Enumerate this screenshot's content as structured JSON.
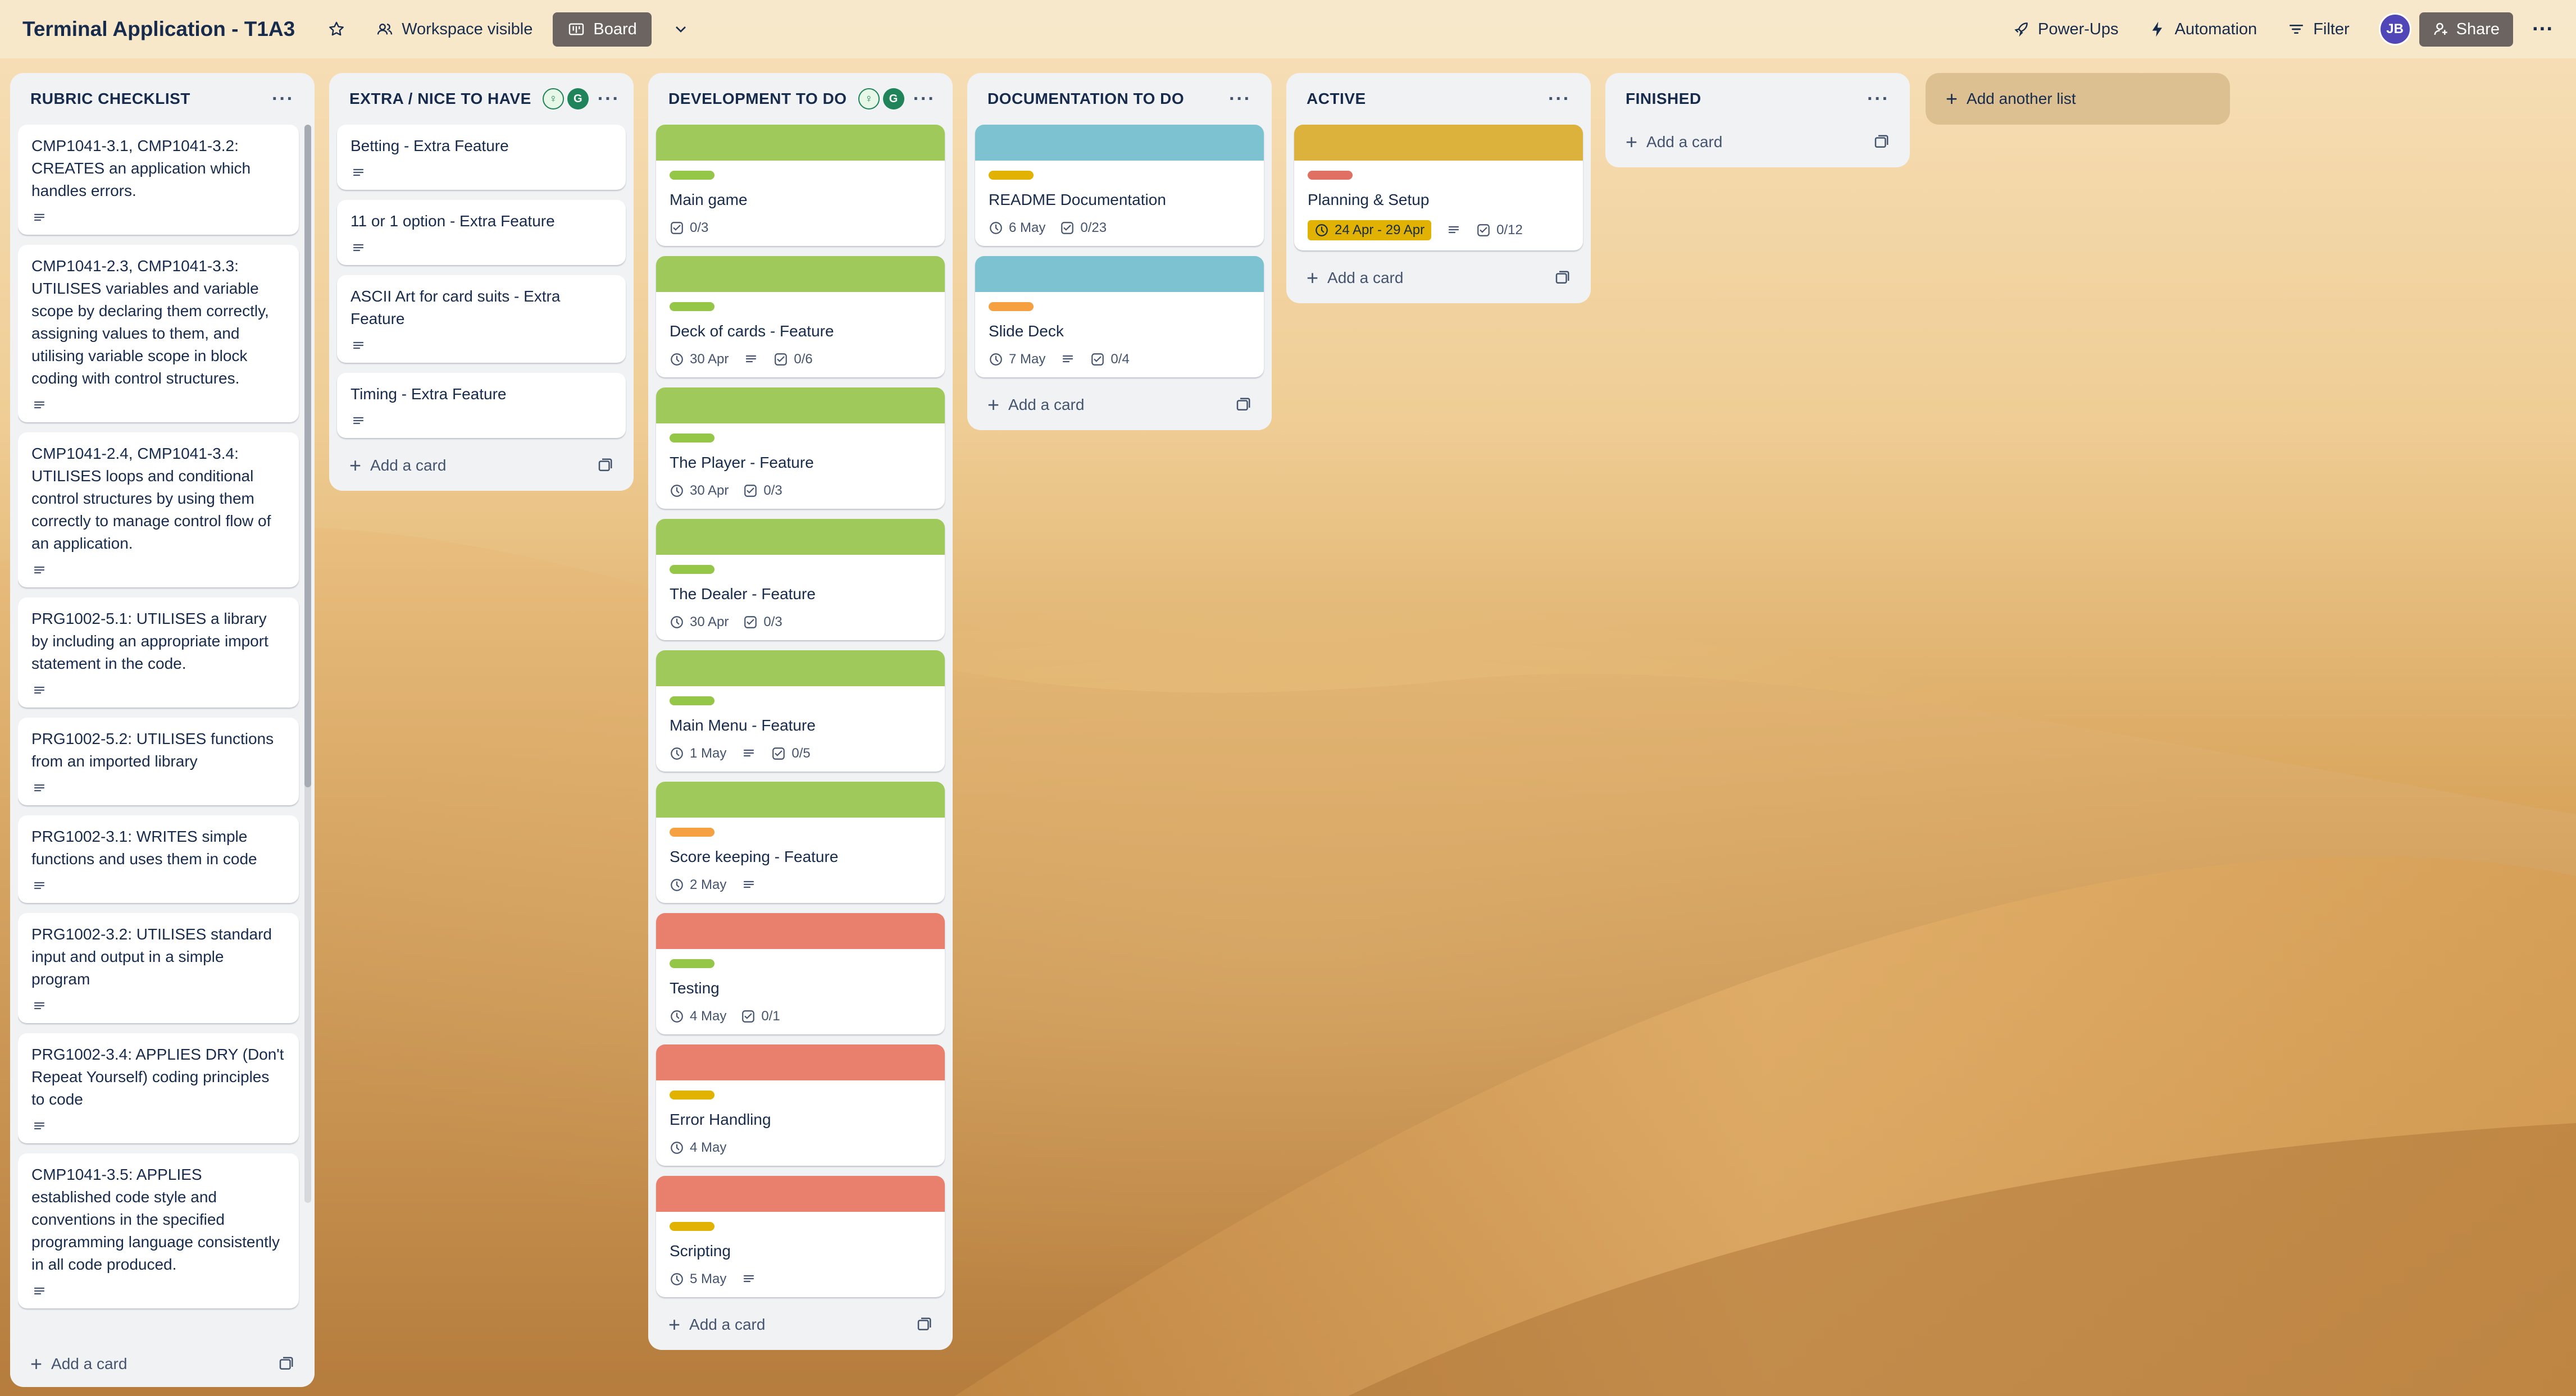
{
  "header": {
    "title": "Terminal Application - T1A3",
    "workspace_visible": "Workspace visible",
    "board_view": "Board",
    "power_ups": "Power-Ups",
    "automation": "Automation",
    "filter": "Filter",
    "avatar_initials": "JB",
    "share": "Share"
  },
  "colors": {
    "green_cover": "#9fc95a",
    "teal_cover": "#7cc2d0",
    "yellow_cover": "#dcb23c",
    "red_cover": "#e97f6d",
    "green_label": "#94c748",
    "yellow_label": "#e2b203",
    "orange_label": "#f5a142",
    "red_label": "#e07063"
  },
  "lists": {
    "rubric": {
      "title": "RUBRIC CHECKLIST",
      "add_card": "Add a card",
      "cards": [
        "CMP1041-3.1, CMP1041-3.2: CREATES an application which handles errors.",
        "CMP1041-2.3, CMP1041-3.3: UTILISES variables and variable scope by declaring them correctly, assigning values to them, and utilising variable scope in block coding with control structures.",
        "CMP1041-2.4, CMP1041-3.4: UTILISES loops and conditional control structures by using them correctly to manage control flow of an application.",
        "PRG1002-5.1: UTILISES a library by including an appropriate import statement in the code.",
        "PRG1002-5.2: UTILISES functions from an imported library",
        "PRG1002-3.1: WRITES simple functions and uses them in code",
        "PRG1002-3.2: UTILISES standard input and output in a simple program",
        "PRG1002-3.4: APPLIES DRY (Don't Repeat Yourself) coding principles to code",
        "CMP1041-3.5: APPLIES established code style and conventions in the specified programming language consistently in all code produced."
      ]
    },
    "extra": {
      "title": "EXTRA / NICE TO HAVE",
      "add_card": "Add a card",
      "cards": [
        "Betting - Extra Feature",
        "11 or 1 option - Extra Feature",
        "ASCII Art for card suits - Extra Feature",
        "Timing - Extra Feature"
      ]
    },
    "dev": {
      "title": "DEVELOPMENT TO DO",
      "add_card": "Add a card",
      "cards": [
        {
          "title": "Main game",
          "date": "",
          "checklist": "0/3"
        },
        {
          "title": "Deck of cards - Feature",
          "date": "30 Apr",
          "checklist": "0/6"
        },
        {
          "title": "The Player - Feature",
          "date": "30 Apr",
          "checklist": "0/3"
        },
        {
          "title": "The Dealer - Feature",
          "date": "30 Apr",
          "checklist": "0/3"
        },
        {
          "title": "Main Menu - Feature",
          "date": "1 May",
          "checklist": "0/5"
        },
        {
          "title": "Score keeping - Feature",
          "date": "2 May",
          "checklist": ""
        },
        {
          "title": "Testing",
          "date": "4 May",
          "checklist": "0/1"
        },
        {
          "title": "Error Handling",
          "date": "4 May",
          "checklist": ""
        },
        {
          "title": "Scripting",
          "date": "5 May",
          "checklist": ""
        }
      ]
    },
    "docs": {
      "title": "DOCUMENTATION TO DO",
      "add_card": "Add a card",
      "cards": [
        {
          "title": "README Documentation",
          "date": "6 May",
          "checklist": "0/23"
        },
        {
          "title": "Slide Deck",
          "date": "7 May",
          "checklist": "0/4"
        }
      ]
    },
    "active": {
      "title": "ACTIVE",
      "add_card": "Add a card",
      "cards": [
        {
          "title": "Planning & Setup",
          "date": "24 Apr - 29 Apr",
          "checklist": "0/12"
        }
      ]
    },
    "finished": {
      "title": "FINISHED",
      "add_card": "Add a card"
    }
  },
  "add_list": "Add another list"
}
